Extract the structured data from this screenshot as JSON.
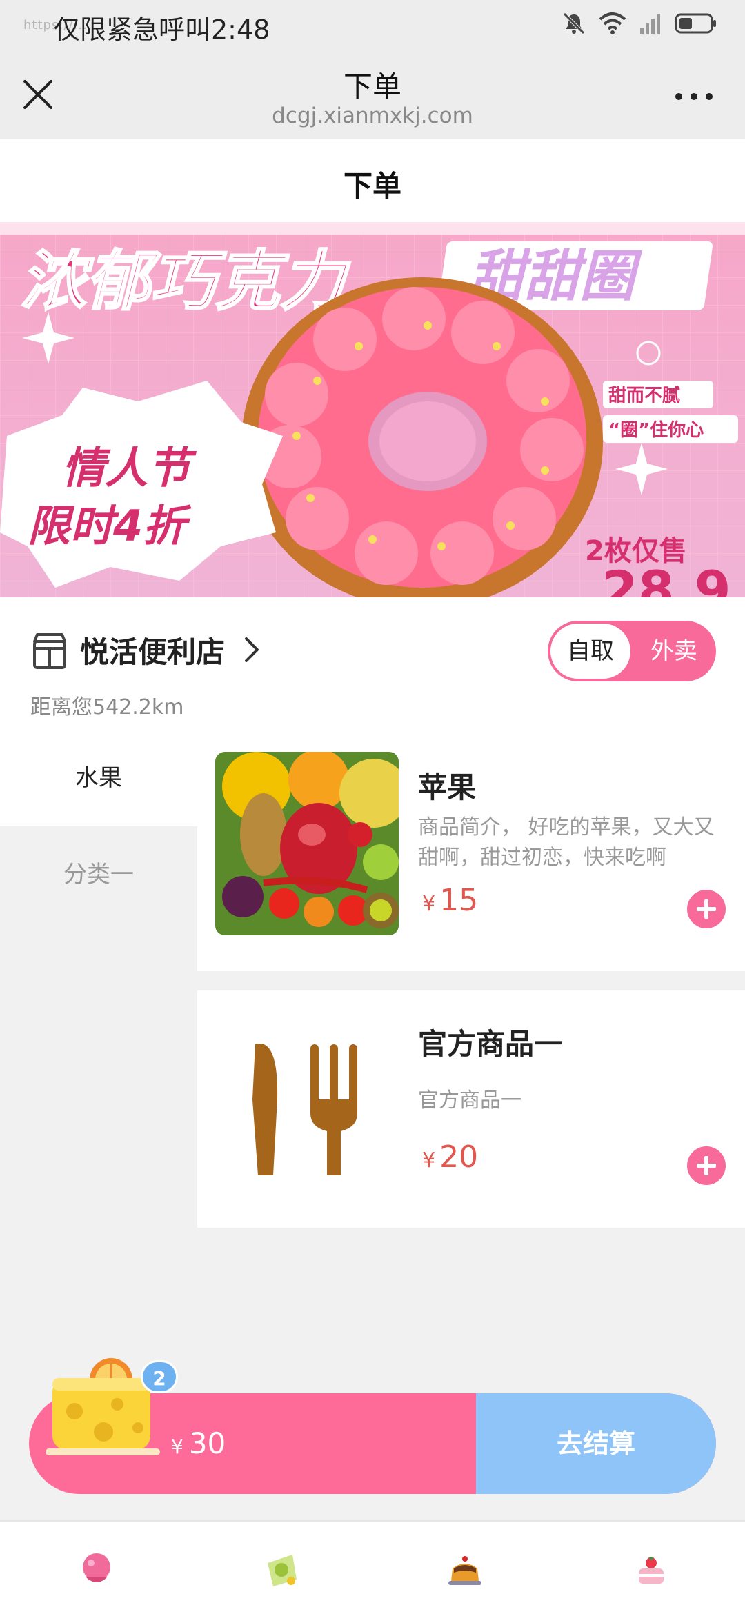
{
  "status_bar": {
    "text": "仅限紧急呼叫2:48",
    "url_ghost": "https://..."
  },
  "nav": {
    "title": "下单",
    "url": "dcgj.xianmxkj.com"
  },
  "page": {
    "title": "下单"
  },
  "banner": {
    "headline": "浓郁巧克力",
    "tag": "甜甜圈",
    "promo_line1": "情人节",
    "promo_line2": "限时4折",
    "side_line1": "甜而不腻",
    "side_line2": "“圈”住你心",
    "price_label": "2枚仅售",
    "price_partial": "28.9"
  },
  "store": {
    "name": "悦活便利店",
    "distance": "距离您542.2km",
    "mode_pickup": "自取",
    "mode_delivery": "外卖"
  },
  "categories": [
    {
      "label": "水果"
    },
    {
      "label": "分类一"
    }
  ],
  "products": [
    {
      "name": "苹果",
      "desc": "商品简介， 好吃的苹果，又大又甜啊，甜过初恋，快来吃啊",
      "currency": "¥",
      "price": "15",
      "image_icon": "fruit-photo"
    },
    {
      "name": "官方商品一",
      "desc": "官方商品一",
      "currency": "¥",
      "price": "20",
      "image_icon": "knife-fork-icon"
    }
  ],
  "cart": {
    "badge": "2",
    "currency": "¥",
    "total": "30",
    "checkout_label": "去结算"
  },
  "tabs": [
    {
      "icon": "pink-cake-icon"
    },
    {
      "icon": "green-cake-icon"
    },
    {
      "icon": "pudding-icon"
    },
    {
      "icon": "strawberry-cake-icon"
    }
  ],
  "colors": {
    "accent_pink": "#ff6b98",
    "checkout_blue": "#8fc4f8",
    "price_red": "#e0574f"
  }
}
